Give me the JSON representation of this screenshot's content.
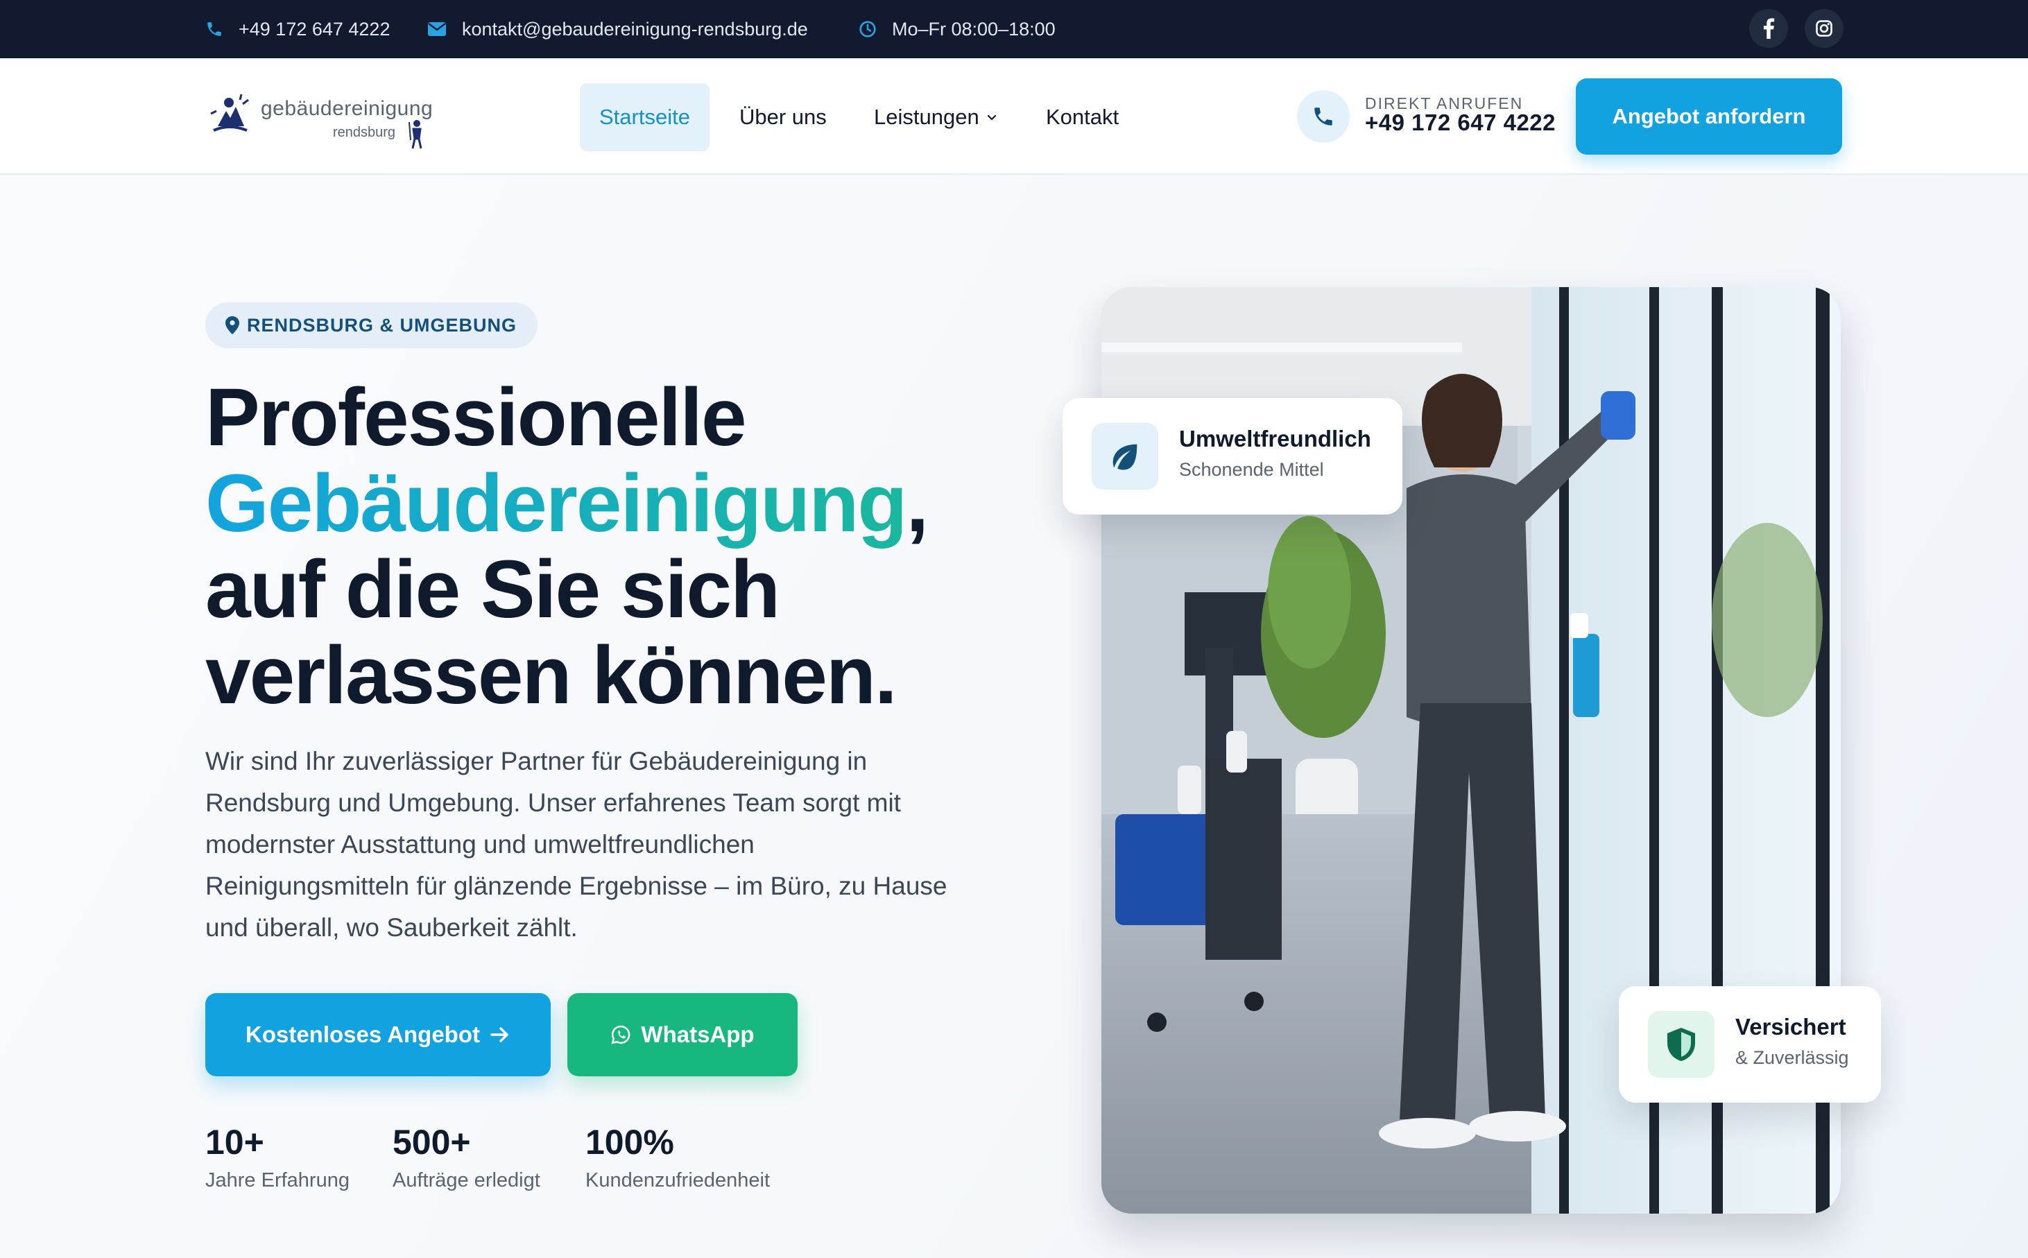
{
  "topbar": {
    "phone": "+49 172 647 4222",
    "email": "kontakt@gebaudereinigung-rendsburg.de",
    "hours": "Mo–Fr 08:00–18:00",
    "social": [
      {
        "icon": "facebook-icon"
      },
      {
        "icon": "instagram-icon"
      }
    ]
  },
  "logo": {
    "line1": "gebäudereinigung",
    "line2": "rendsburg"
  },
  "nav": {
    "items": [
      {
        "label": "Startseite",
        "active": true
      },
      {
        "label": "Über uns"
      },
      {
        "label": "Leistungen",
        "has_dropdown": true
      },
      {
        "label": "Kontakt"
      }
    ]
  },
  "header_call": {
    "label": "DIREKT ANRUFEN",
    "number": "+49 172 647 4222"
  },
  "header_cta": "Angebot anfordern",
  "hero": {
    "location": "RENDSBURG & UMGEBUNG",
    "headline_1": "Professionelle",
    "headline_highlight": "Gebäudereinigung",
    "headline_comma": ",",
    "headline_2": "auf die Sie sich",
    "headline_3": "verlassen können.",
    "lead": "Wir sind Ihr zuverlässiger Partner für Gebäudereinigung in Rendsburg und Umgebung. Unser erfahrenes Team sorgt mit modernster Ausstattung und umweltfreundlichen Reinigungsmitteln für glänzende Ergebnisse – im Büro, zu Hause und überall, wo Sauberkeit zählt.",
    "primary_button": "Kostenloses Angebot",
    "whatsapp_button": "WhatsApp",
    "stats": [
      {
        "value": "10+",
        "label": "Jahre Erfahrung"
      },
      {
        "value": "500+",
        "label": "Aufträge erledigt"
      },
      {
        "value": "100%",
        "label": "Kundenzufriedenheit"
      }
    ]
  },
  "badges": {
    "eco": {
      "title": "Umweltfreundlich",
      "subtitle": "Schonende Mittel",
      "icon": "leaf-icon"
    },
    "insured": {
      "title": "Versichert",
      "subtitle": "& Zuverlässig",
      "icon": "shield-icon"
    }
  },
  "colors": {
    "accent": "#12a2e0",
    "whatsapp": "#17b77f",
    "dark": "#111a2e"
  }
}
